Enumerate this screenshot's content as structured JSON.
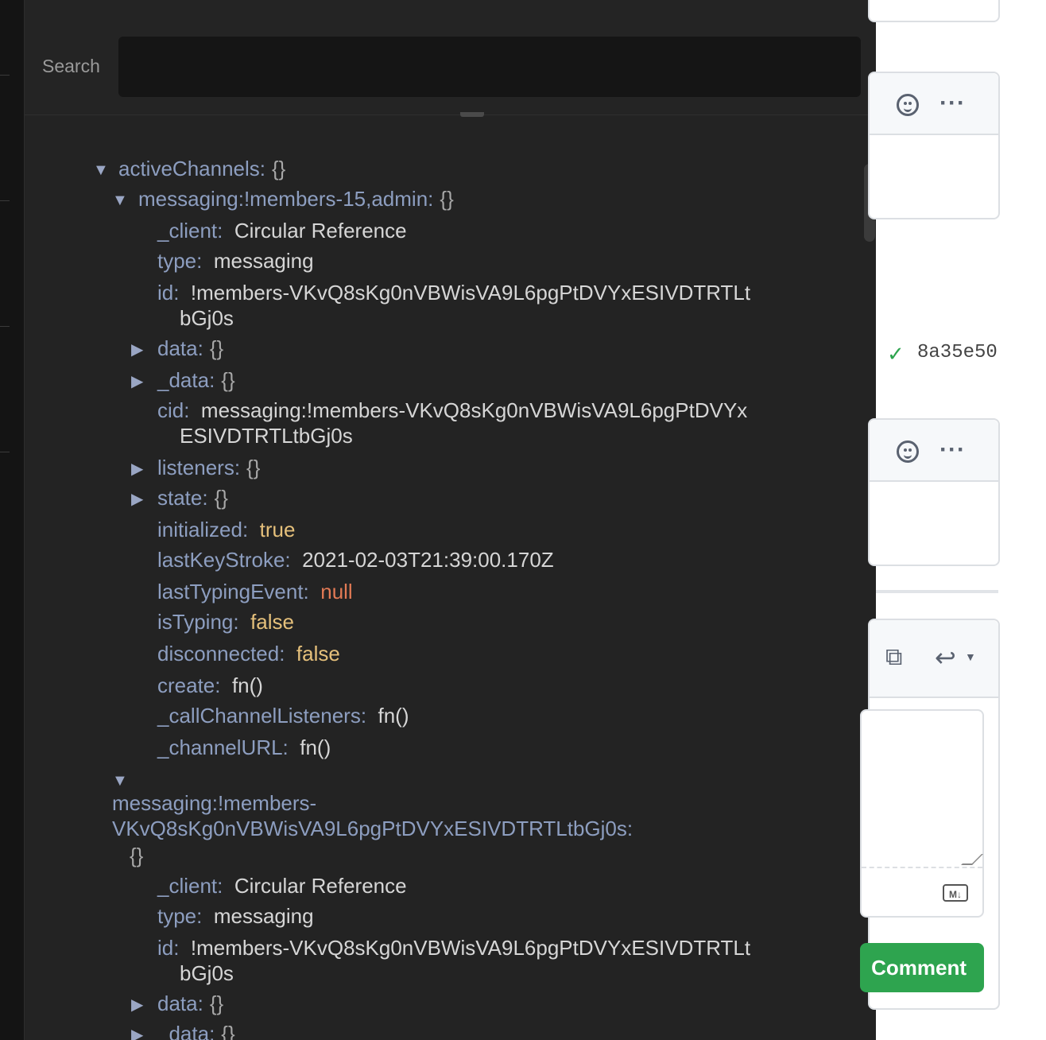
{
  "search": {
    "label": "Search",
    "value": ""
  },
  "tree": {
    "root_key": "activeChannels:",
    "root_brace": "{}",
    "ch1": {
      "key": "messaging:!members-15,admin:",
      "brace": "{}",
      "client_key": "_client:",
      "client_val": "Circular Reference",
      "type_key": "type:",
      "type_val": "messaging",
      "id_key": "id:",
      "id_val_l1": "!members-VKvQ8sKg0nVBWisVA9L6pgPtDVYxESIVDTRTLt",
      "id_val_l2": "bGj0s",
      "data_key": "data:",
      "data_brace": "{}",
      "udata_key": "_data:",
      "udata_brace": "{}",
      "cid_key": "cid:",
      "cid_val_l1": "messaging:!members-VKvQ8sKg0nVBWisVA9L6pgPtDVYx",
      "cid_val_l2": "ESIVDTRTLtbGj0s",
      "listeners_key": "listeners:",
      "listeners_brace": "{}",
      "state_key": "state:",
      "state_brace": "{}",
      "initialized_key": "initialized:",
      "initialized_val": "true",
      "lastKeyStroke_key": "lastKeyStroke:",
      "lastKeyStroke_val": "2021-02-03T21:39:00.170Z",
      "lastTypingEvent_key": "lastTypingEvent:",
      "lastTypingEvent_val": "null",
      "isTyping_key": "isTyping:",
      "isTyping_val": "false",
      "disconnected_key": "disconnected:",
      "disconnected_val": "false",
      "create_key": "create:",
      "create_val": "fn()",
      "callListeners_key": "_callChannelListeners:",
      "callListeners_val": "fn()",
      "channelURL_key": "_channelURL:",
      "channelURL_val": "fn()"
    },
    "ch2": {
      "key_l1": "messaging:!members-",
      "key_l2": "VKvQ8sKg0nVBWisVA9L6pgPtDVYxESIVDTRTLtbGj0s:",
      "brace": "{}",
      "client_key": "_client:",
      "client_val": "Circular Reference",
      "type_key": "type:",
      "type_val": "messaging",
      "id_key": "id:",
      "id_val_l1": "!members-VKvQ8sKg0nVBWisVA9L6pgPtDVYxESIVDTRTLt",
      "id_val_l2": "bGj0s",
      "data_key": "data:",
      "data_brace": "{}",
      "udata_key": "_data:",
      "udata_brace": "{}"
    }
  },
  "github": {
    "commit_hash": "8a35e50",
    "comment_button": "Comment",
    "markdown_badge": "M↓"
  },
  "colors": {
    "panel_bg": "#232323",
    "key": "#8d9ec0",
    "bool": "#e5c07b",
    "null": "#e27a55",
    "button_green": "#2ea44f"
  }
}
